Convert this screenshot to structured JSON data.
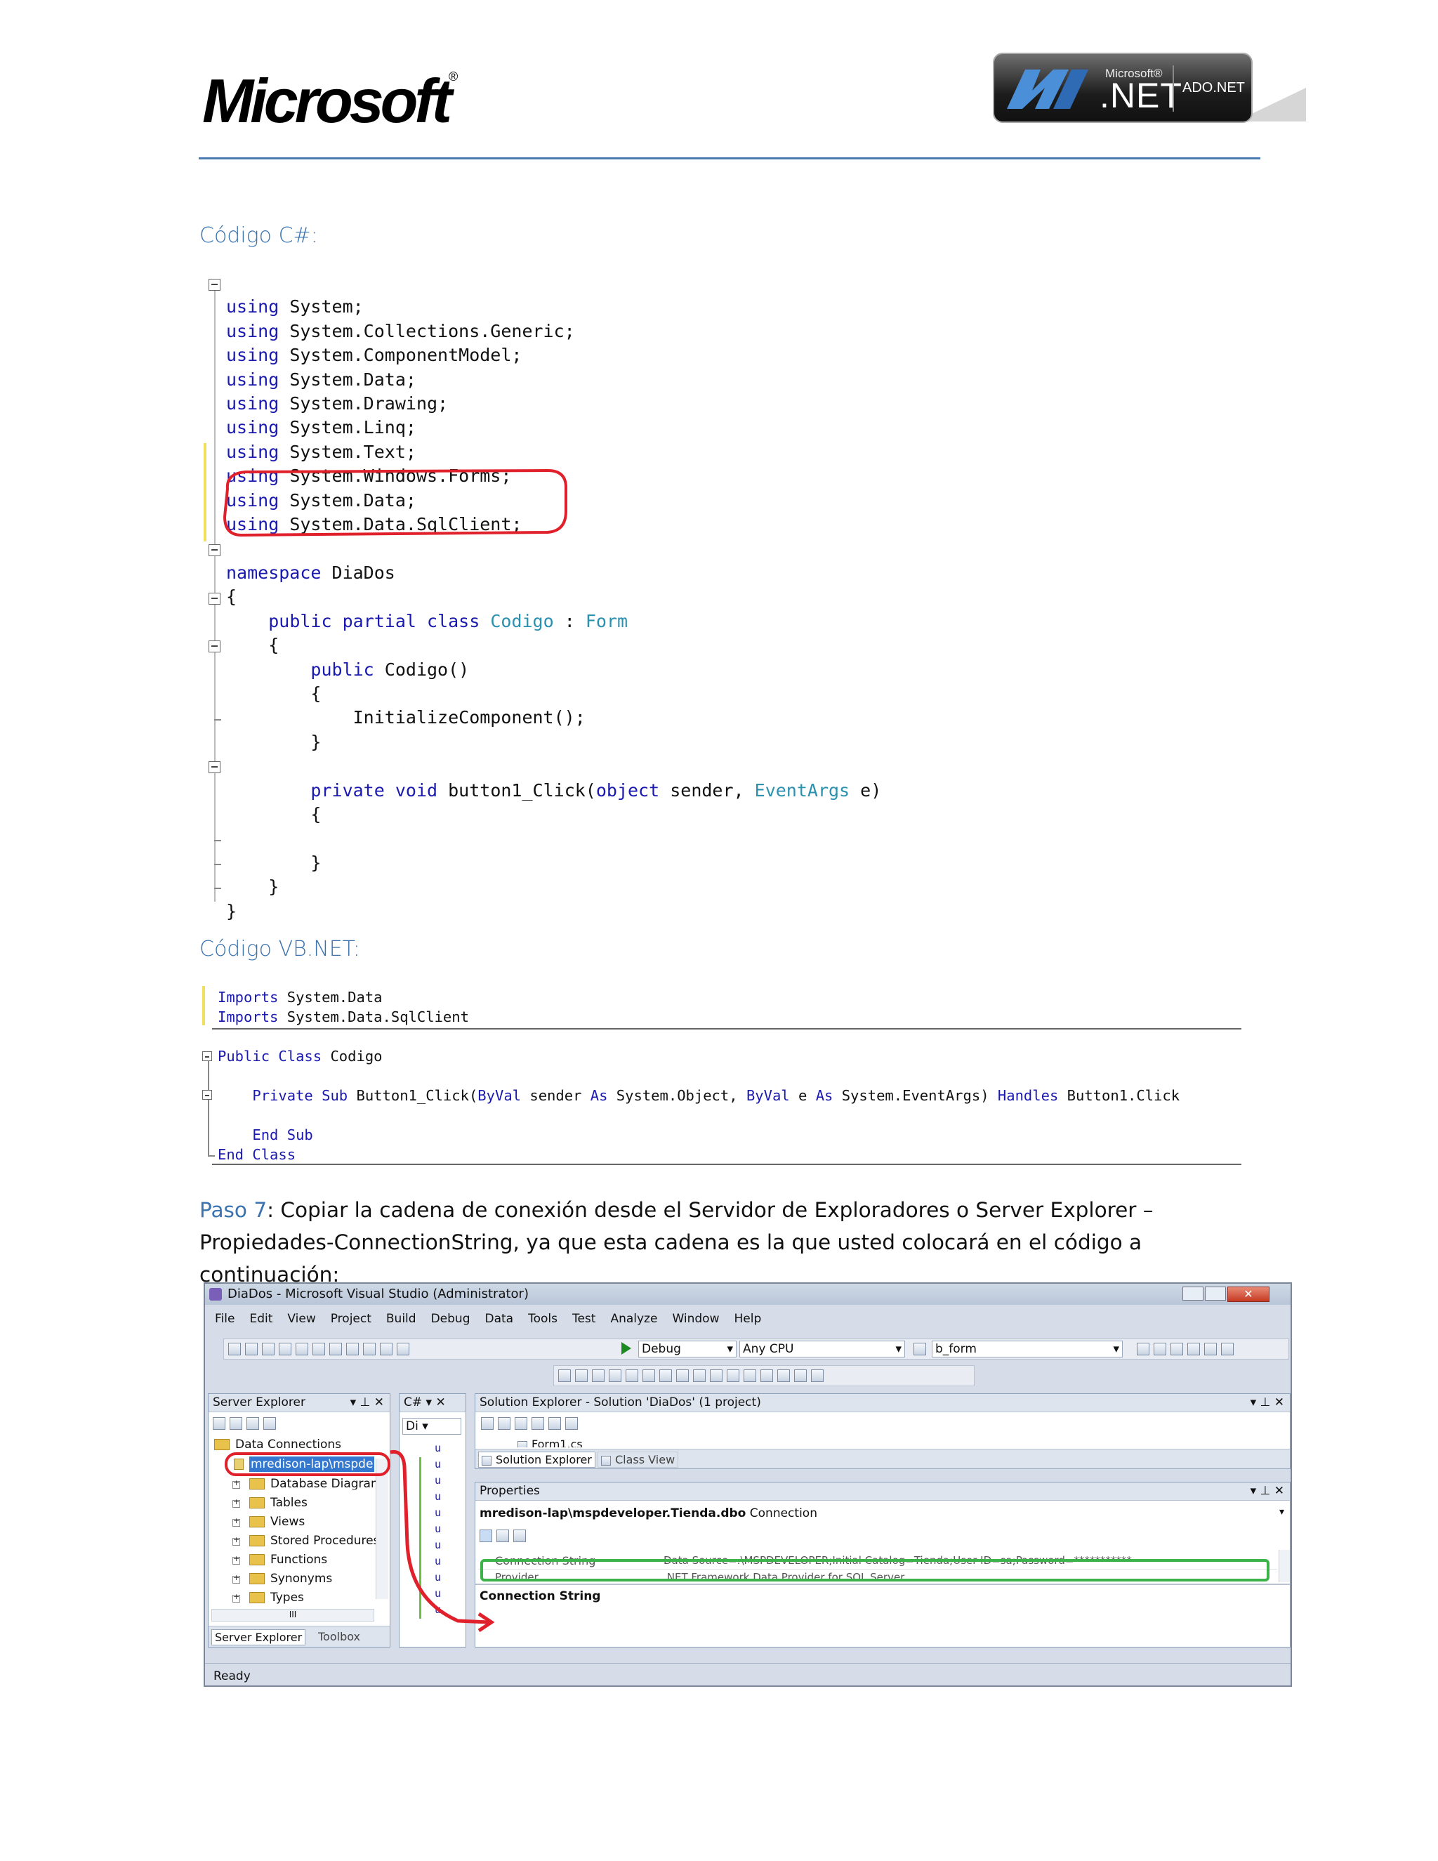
{
  "header": {
    "logo_text": "Microsoft",
    "badge_ms": "Microsoft®",
    "badge_net": ".NET",
    "badge_ado": "ADO.NET"
  },
  "csharp": {
    "heading": "Código C#:",
    "usings": [
      "System;",
      "System.Collections.Generic;",
      "System.ComponentModel;",
      "System.Data;",
      "System.Drawing;",
      "System.Linq;",
      "System.Text;",
      "System.Windows.Forms;",
      "System.Data;",
      "System.Data.SqlClient;"
    ],
    "kw_using": "using",
    "kw_namespace": "namespace",
    "namespace_name": "DiaDos",
    "open_brace": "{",
    "close_brace": "}",
    "kw_public": "public",
    "kw_partial": "partial",
    "kw_class": "class",
    "class_name": "Codigo",
    "colon": ":",
    "base_class": "Form",
    "ctor": "Codigo()",
    "init_call": "InitializeComponent();",
    "kw_private": "private",
    "kw_void": "void",
    "method_name": "button1_Click(",
    "kw_object": "object",
    "sender_part": "sender,",
    "type_eventargs": "EventArgs",
    "e_part": "e)"
  },
  "vbnet": {
    "heading": "Código VB.NET:",
    "kw_imports": "Imports",
    "imports": [
      "System.Data",
      "System.Data.SqlClient"
    ],
    "kw_public": "Public",
    "kw_class": "Class",
    "class_name": "Codigo",
    "kw_private": "Private",
    "kw_sub": "Sub",
    "sub_name": "Button1_Click(",
    "kw_byval": "ByVal",
    "sender": "sender",
    "kw_as": "As",
    "type_object": "System.Object,",
    "e": "e",
    "type_eventargs": "System.EventArgs)",
    "kw_handles": "Handles",
    "handles_target": "Button1.Click",
    "kw_end": "End"
  },
  "paragraph": {
    "step": "Paso 7",
    "text": ": Copiar la cadena de conexión desde el Servidor de Exploradores o Server Explorer – Propiedades-ConnectionString, ya que esta cadena es la que usted colocará en el código a continuación:"
  },
  "vs": {
    "title": "DiaDos - Microsoft Visual Studio (Administrator)",
    "menu": [
      "File",
      "Edit",
      "View",
      "Project",
      "Build",
      "Debug",
      "Data",
      "Tools",
      "Test",
      "Analyze",
      "Window",
      "Help"
    ],
    "config": "Debug",
    "platform": "Any CPU",
    "find_box": "b_form",
    "server_explorer": {
      "title": "Server Explorer",
      "data_connections": "Data Connections",
      "selected_connection": "mredison-lap\\mspde",
      "items": [
        "Database Diagram",
        "Tables",
        "Views",
        "Stored Procedures",
        "Functions",
        "Synonyms",
        "Types"
      ],
      "tab_server": "Server Explorer",
      "tab_toolbox": "Toolbox",
      "scroll_glyph": "III"
    },
    "code_pane": {
      "tab": "C#",
      "dropdown": "Di",
      "lines": [
        "u",
        "u",
        "u",
        "u",
        "u",
        "u",
        "u",
        "u",
        "u",
        "u",
        "u"
      ]
    },
    "solution_explorer": {
      "title": "Solution Explorer - Solution 'DiaDos' (1 project)",
      "item": "Form1.cs",
      "tab_solution": "Solution Explorer",
      "tab_class": "Class View"
    },
    "properties": {
      "title": "Properties",
      "object": "mredison-lap\\mspdeveloper.Tienda.dbo",
      "object_type": "Connection",
      "rows": [
        {
          "name": "Connection String",
          "value": "Data Source=.\\MSPDEVELOPER;Initial Catalog=Tienda;User ID=sa;Password=***********"
        },
        {
          "name": "Provider",
          "value": ".NET Framework Data Provider for SQL Server"
        }
      ],
      "description_title": "Connection String"
    },
    "status": "Ready"
  }
}
